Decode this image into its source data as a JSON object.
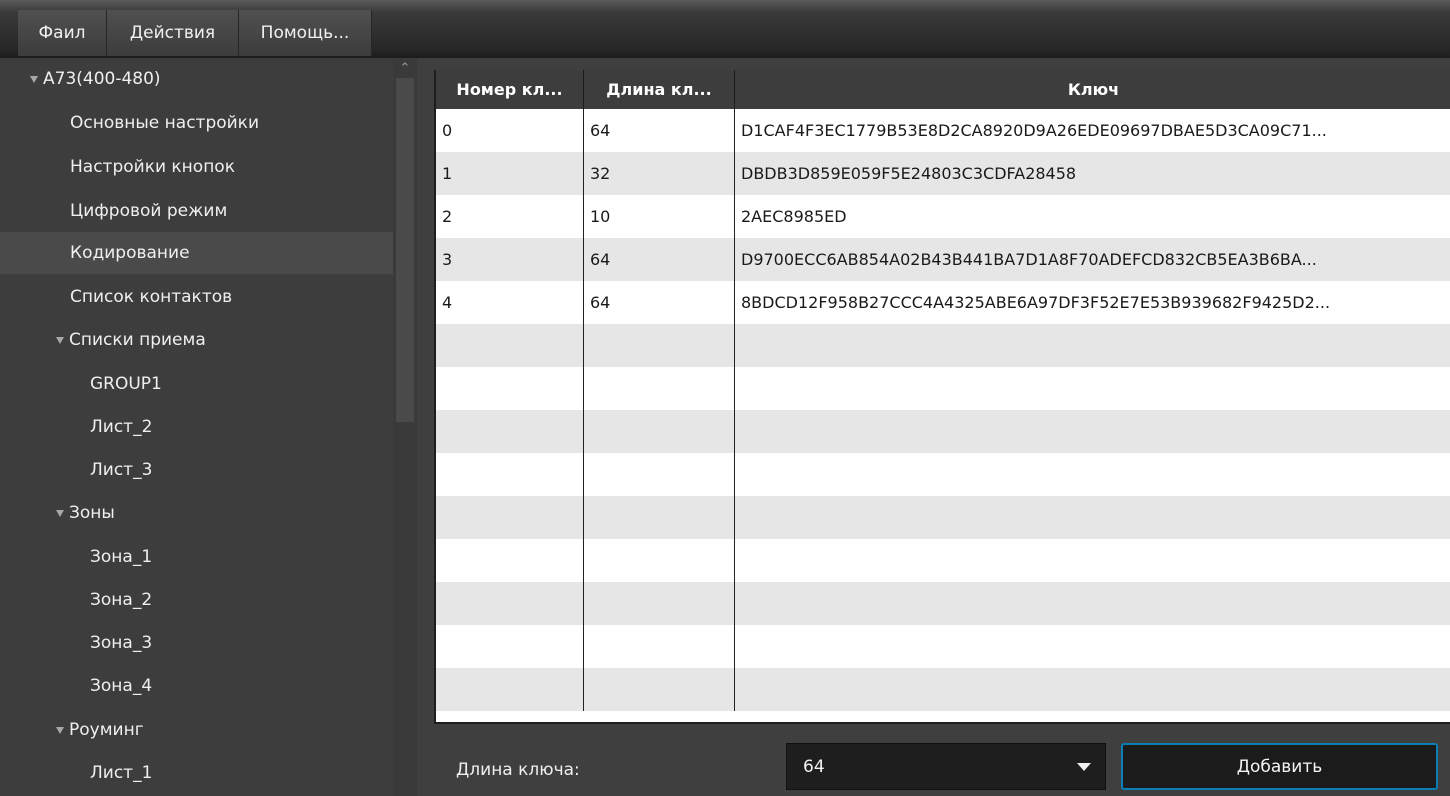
{
  "menu": {
    "items": [
      "Фаил",
      "Действия",
      "Помощь..."
    ]
  },
  "tree": {
    "items": [
      {
        "label": "A73(400-480)",
        "expanded": true
      },
      {
        "label": "Основные настройки"
      },
      {
        "label": "Настройки кнопок"
      },
      {
        "label": "Цифровой режим"
      },
      {
        "label": "Кодирование",
        "selected": true
      },
      {
        "label": "Список контактов"
      },
      {
        "label": "Списки приема",
        "expanded": true
      },
      {
        "label": "GROUP1"
      },
      {
        "label": "Лист_2"
      },
      {
        "label": "Лист_3"
      },
      {
        "label": "Зоны",
        "expanded": true
      },
      {
        "label": "Зона_1"
      },
      {
        "label": "Зона_2"
      },
      {
        "label": "Зона_3"
      },
      {
        "label": "Зона_4"
      },
      {
        "label": "Роуминг",
        "expanded": true
      },
      {
        "label": "Лист_1"
      }
    ]
  },
  "table": {
    "headers": [
      "Номер кл...",
      "Длина кл...",
      "Ключ"
    ],
    "rows": [
      [
        "0",
        "64",
        "D1CAF4F3EC1779B53E8D2CA8920D9A26EDE09697DBAE5D3CA09C71..."
      ],
      [
        "1",
        "32",
        "DBDB3D859E059F5E24803C3CDFA28458"
      ],
      [
        "2",
        "10",
        "2AEC8985ED"
      ],
      [
        "3",
        "64",
        "D9700ECC6AB854A02B43B441BA7D1A8F70ADEFCD832CB5EA3B6BA..."
      ],
      [
        "4",
        "64",
        "8BDCD12F958B27CCC4A4325ABE6A97DF3F52E7E53B939682F9425D2..."
      ]
    ]
  },
  "controls": {
    "key_length_label": "Длина ключа:",
    "key_length_value": "64",
    "add_button": "Добавить"
  },
  "colors": {
    "accent": "#0a7fb5",
    "row_alt": "#e6e6e6",
    "panel": "#3d3d3d"
  }
}
